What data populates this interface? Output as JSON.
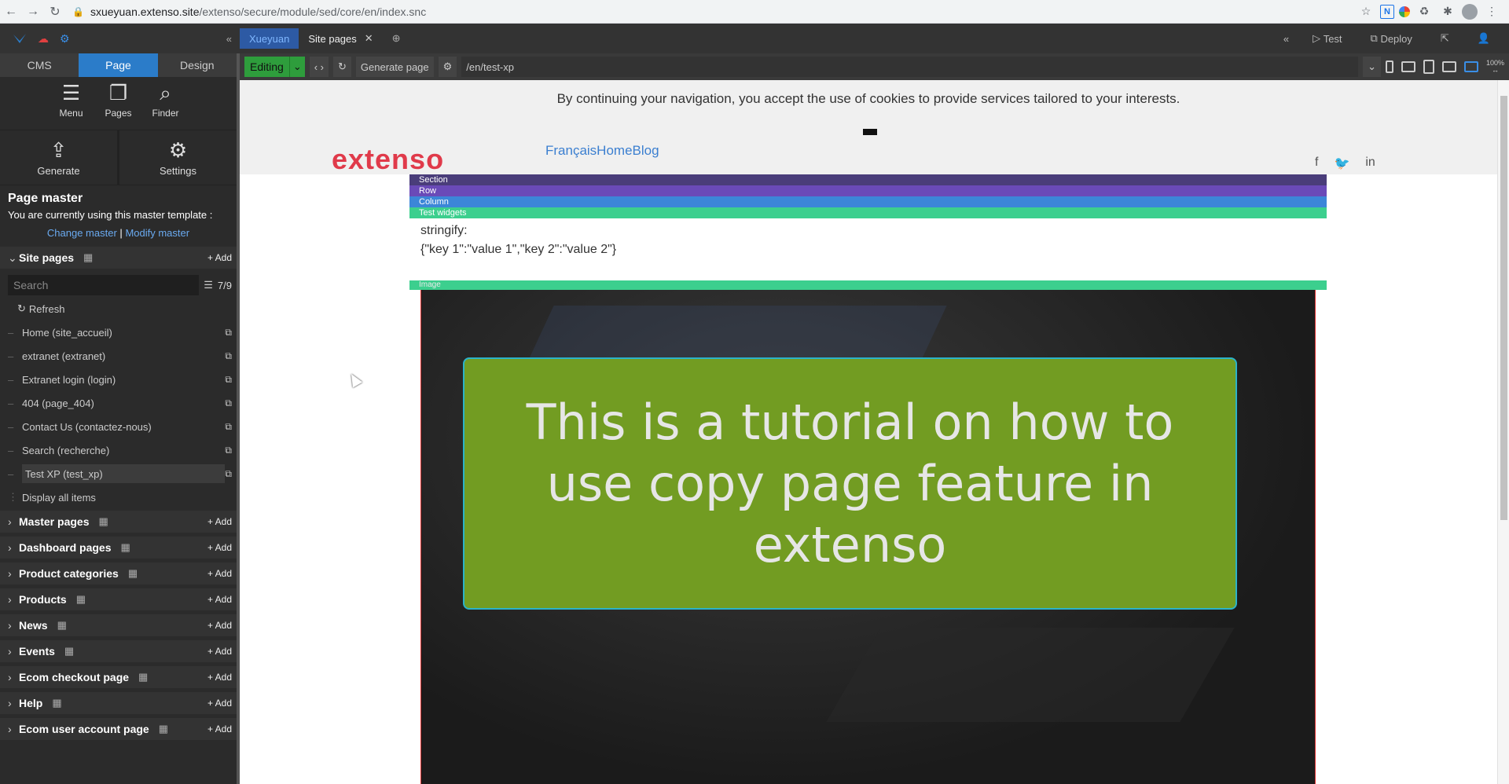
{
  "browser": {
    "url_host": "sxueyuan.extenso.site",
    "url_path": "/extenso/secure/module/sed/core/en/index.snc"
  },
  "appbar": {
    "tabs": [
      {
        "label": "Xueyuan",
        "active": true
      },
      {
        "label": "Site pages",
        "active": false
      }
    ],
    "test_label": "Test",
    "deploy_label": "Deploy"
  },
  "sidebar": {
    "tabs": [
      "CMS",
      "Page",
      "Design"
    ],
    "tools": [
      {
        "label": "Menu",
        "icon": "menu-edit-icon"
      },
      {
        "label": "Pages",
        "icon": "pages-icon"
      },
      {
        "label": "Finder",
        "icon": "finder-icon"
      }
    ],
    "tools2": [
      {
        "label": "Generate",
        "icon": "generate-icon"
      },
      {
        "label": "Settings",
        "icon": "gear-icon"
      }
    ],
    "master": {
      "title": "Page master",
      "text": "You are currently using this master template :",
      "change": "Change master",
      "sep": "|",
      "modify": "Modify master"
    },
    "site_pages": {
      "title": "Site pages",
      "add": "+ Add",
      "search_placeholder": "Search",
      "count": "7/9",
      "refresh": "Refresh",
      "items": [
        "Home (site_accueil)",
        "extranet (extranet)",
        "Extranet login (login)",
        "404 (page_404)",
        "Contact Us (contactez-nous)",
        "Search (recherche)",
        "Test XP (test_xp)"
      ],
      "display_all": "Display all items"
    },
    "sections": [
      "Master pages",
      "Dashboard pages",
      "Product categories",
      "Products",
      "News",
      "Events",
      "Ecom checkout page",
      "Help",
      "Ecom user account page"
    ],
    "add_label": "+ Add"
  },
  "editor": {
    "mode": "Editing",
    "generate": "Generate page",
    "path": "/en/test-xp",
    "zoom": "100%"
  },
  "canvas": {
    "cookie": "By continuing your navigation, you accept the use of cookies to provide services tailored to your interests.",
    "brand": "extenso",
    "nav": "FrançaisHomeBlog",
    "labels": {
      "section": "Section",
      "row": "Row",
      "column": "Column",
      "widgets": "Test widgets",
      "image": "Image"
    },
    "stringify_label": "stringify:",
    "stringify_value": "{\"key 1\":\"value 1\",\"key 2\":\"value 2\"}",
    "headline": "This is a tutorial on how to use copy page feature in extenso"
  }
}
